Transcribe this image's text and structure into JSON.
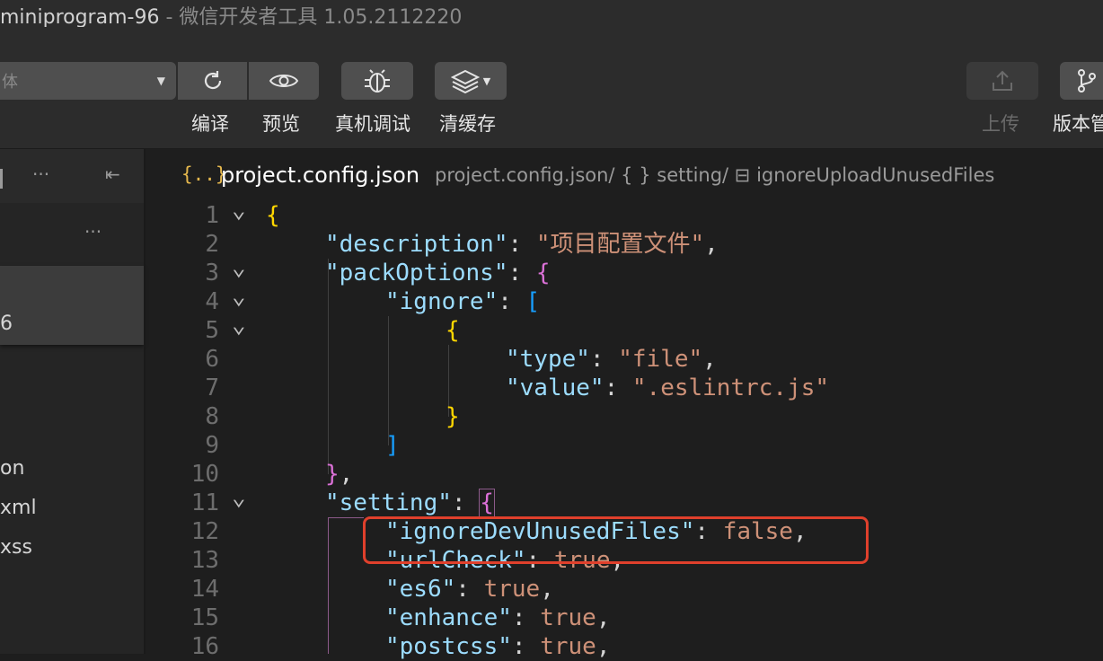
{
  "window": {
    "title_name": "miniprogram-96",
    "title_rest": " - 微信开发者工具 1.05.2112220"
  },
  "toolbar": {
    "mode_text": "体",
    "compile_label": "编译",
    "preview_label": "预览",
    "realdebug_label": "真机调试",
    "clearcache_label": "清缓存",
    "upload_label": "上传",
    "version_label": "版本管"
  },
  "sidebar": {
    "more1": "···",
    "more2": "···",
    "collapse": "⇤",
    "selected_item": "6",
    "files": [
      "on",
      "xml",
      "xss"
    ]
  },
  "editor": {
    "tab_icon": "{..}",
    "tab_name": "project.config.json",
    "breadcrumb": "project.config.json/ { } setting/ ⊟ ignoreUploadUnusedFiles"
  },
  "code_lines": [
    {
      "n": "1",
      "fold": true
    },
    {
      "n": "2",
      "fold": false
    },
    {
      "n": "3",
      "fold": true
    },
    {
      "n": "4",
      "fold": true
    },
    {
      "n": "5",
      "fold": true
    },
    {
      "n": "6",
      "fold": false
    },
    {
      "n": "7",
      "fold": false
    },
    {
      "n": "8",
      "fold": false
    },
    {
      "n": "9",
      "fold": false
    },
    {
      "n": "10",
      "fold": false
    },
    {
      "n": "11",
      "fold": true
    },
    {
      "n": "12",
      "fold": false
    },
    {
      "n": "13",
      "fold": false
    },
    {
      "n": "14",
      "fold": false
    },
    {
      "n": "15",
      "fold": false
    },
    {
      "n": "16",
      "fold": false
    }
  ],
  "code_text": {
    "l1": "{",
    "l2_key": "\"description\"",
    "l2_val": "\"项目配置文件\"",
    "l3_key": "\"packOptions\"",
    "l4_key": "\"ignore\"",
    "l6_key": "\"type\"",
    "l6_val": "\"file\"",
    "l7_key": "\"value\"",
    "l7_val": "\".eslintrc.js\"",
    "l11_key": "\"setting\"",
    "l12_key": "\"ignoreDevUnusedFiles\"",
    "l12_val": "false",
    "l13_key": "\"urlCheck\"",
    "l13_val": "true",
    "l14_key": "\"es6\"",
    "l14_val": "true",
    "l15_key": "\"enhance\"",
    "l15_val": "true",
    "l16_key": "\"postcss\"",
    "l16_val": "true"
  },
  "colors": {
    "highlight_box": "#e0402c",
    "key": "#9cdcfe",
    "string": "#ce9178"
  }
}
